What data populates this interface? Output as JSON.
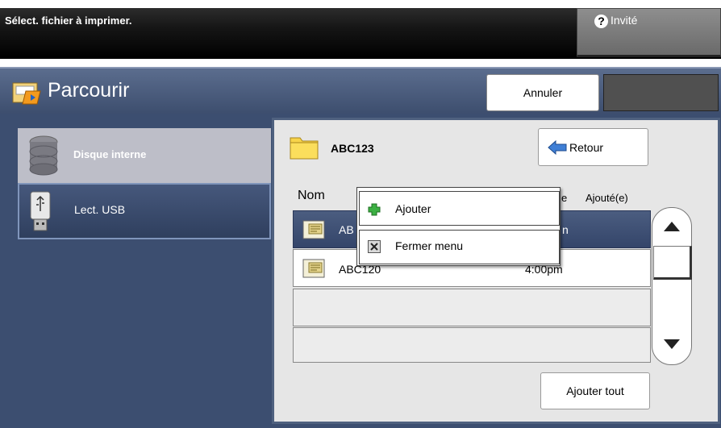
{
  "status_bar": {
    "message": "Sélect. fichier à imprimer.",
    "user_label": "Invité",
    "user_icon": "help-question-icon"
  },
  "header": {
    "title": "Parcourir",
    "title_icon": "folder-browse-icon",
    "cancel_label": "Annuler"
  },
  "sidebar": {
    "items": [
      {
        "label": "Disque interne",
        "icon": "hard-disk-icon",
        "state": "disabled"
      },
      {
        "label": "Lect. USB",
        "icon": "usb-drive-icon",
        "state": "selected"
      }
    ]
  },
  "file_browser": {
    "current_folder": "ABC123",
    "back_label": "Retour",
    "columns": {
      "name": "Nom",
      "partial": "e",
      "added": "Ajouté(e)"
    },
    "rows": [
      {
        "name": "AB",
        "time": "n",
        "selected": true
      },
      {
        "name": "ABC120",
        "time": "4:00pm",
        "selected": false
      }
    ],
    "add_all_label": "Ajouter tout"
  },
  "context_menu": {
    "items": [
      {
        "label": "Ajouter",
        "icon": "add-plus-icon"
      },
      {
        "label": "Fermer menu",
        "icon": "close-x-icon"
      }
    ]
  },
  "colors": {
    "accent": "#3c4e70",
    "selected_row": "#3d4f73",
    "panel": "#e6e6e6"
  }
}
